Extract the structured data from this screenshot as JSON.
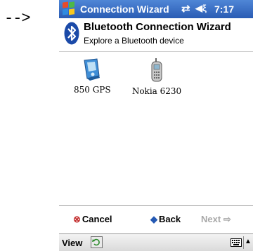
{
  "annotation": {
    "arrow_text": "-->"
  },
  "titlebar": {
    "title": "Connection Wizard",
    "connectivity_glyph": "⇄",
    "volume_glyph": "◀ξ",
    "time": "7:17"
  },
  "header": {
    "title": "Bluetooth Connection Wizard",
    "subtitle": "Explore a Bluetooth device"
  },
  "devices": [
    {
      "label": "850 GPS",
      "icon": "gps-device-icon"
    },
    {
      "label": "Nokia 6230",
      "icon": "mobile-phone-icon"
    }
  ],
  "buttons": {
    "cancel": "Cancel",
    "back": "Back",
    "next": "Next"
  },
  "menubar": {
    "view": "View"
  },
  "colors": {
    "titlebar": "#2a5cb4",
    "cancel_icon": "#c43030",
    "back_icon": "#2459b3",
    "disabled_text": "#a8a8a8"
  }
}
